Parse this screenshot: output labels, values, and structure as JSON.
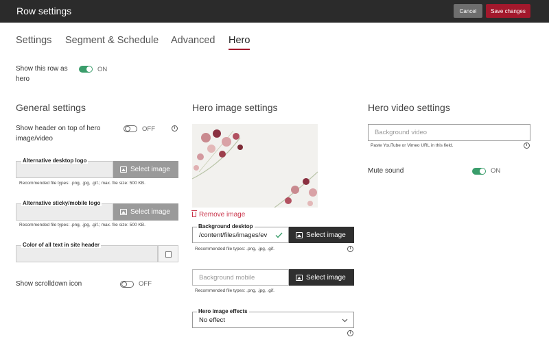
{
  "header": {
    "title": "Row settings",
    "cancel_label": "Cancel",
    "save_label": "Save changes"
  },
  "tabs": [
    {
      "label": "Settings"
    },
    {
      "label": "Segment & Schedule"
    },
    {
      "label": "Advanced"
    },
    {
      "label": "Hero",
      "active": true
    }
  ],
  "show_row_as_hero": {
    "label_line1": "Show this row as",
    "label_line2": "hero",
    "state": "ON"
  },
  "general": {
    "heading": "General settings",
    "show_header": {
      "label_line1": "Show header on top of hero",
      "label_line2": "image/video",
      "state": "OFF"
    },
    "desktop_logo": {
      "legend": "Alternative desktop logo",
      "button": "Select image",
      "hint": "Recommended file types: .png, .jpg, .gif.; max. file size: 500 KB."
    },
    "mobile_logo": {
      "legend": "Alternative sticky/mobile logo",
      "button": "Select image",
      "hint": "Recommended file types: .png, .jpg, .gif.; max. file size: 500 KB."
    },
    "text_color": {
      "legend": "Color of all text in site header"
    },
    "scrolldown": {
      "label": "Show scrolldown icon",
      "state": "OFF"
    }
  },
  "hero_image": {
    "heading": "Hero image settings",
    "remove_label": "Remove image",
    "desktop": {
      "legend": "Background desktop",
      "value": "/content/files/images/ev",
      "button": "Select image",
      "hint": "Recommended file types: .png, .jpg, .gif."
    },
    "mobile": {
      "placeholder": "Background mobile",
      "button": "Select image",
      "hint": "Recommended file types: .png, .jpg, .gif."
    },
    "effects": {
      "legend": "Hero image effects",
      "value": "No effect"
    }
  },
  "hero_video": {
    "heading": "Hero video settings",
    "video": {
      "placeholder": "Background video",
      "hint": "Paste YouTube or Vimeo URL in this field."
    },
    "mute": {
      "label": "Mute sound",
      "state": "ON"
    }
  },
  "colors": {
    "accent": "#a3182c",
    "toggle_on": "#3a9d6b",
    "topbar": "#2b2b2b",
    "remove": "#c9344a"
  },
  "icons": [
    "info-icon",
    "image-icon",
    "check-icon",
    "trash-icon",
    "chevron-down-icon",
    "color-picker-icon"
  ]
}
